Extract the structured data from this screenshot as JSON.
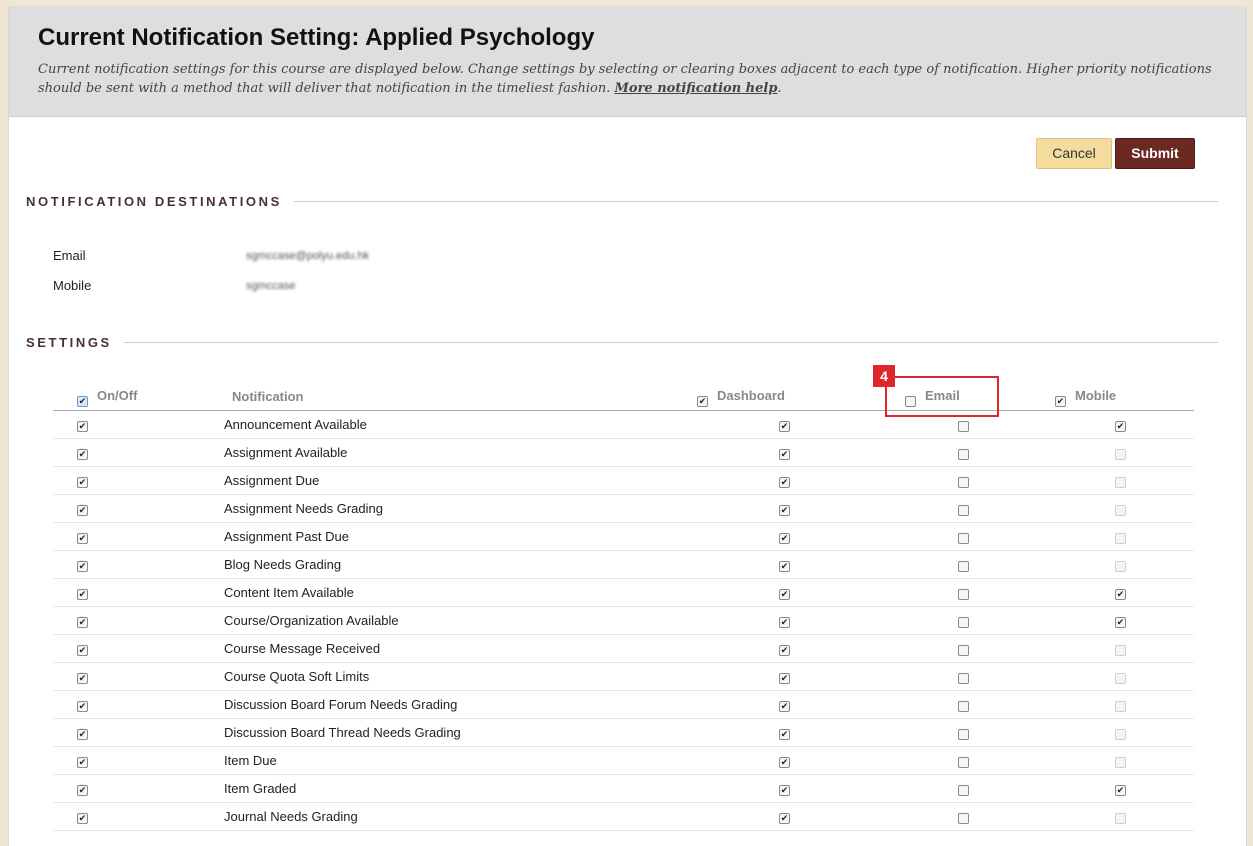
{
  "header": {
    "title": "Current Notification Setting: Applied Psychology",
    "description": "Current notification settings for this course are displayed below. Change settings by selecting or clearing boxes adjacent to each type of notification. Higher priority notifications should be sent with a method that will deliver that notification in the timeliest fashion.",
    "help_link": "More notification help",
    "help_suffix": "."
  },
  "buttons": {
    "cancel": "Cancel",
    "submit": "Submit"
  },
  "destinations": {
    "title": "NOTIFICATION DESTINATIONS",
    "email_label": "Email",
    "email_value": "sgmccase@polyu.edu.hk",
    "mobile_label": "Mobile",
    "mobile_value": "sgmccase"
  },
  "settings": {
    "title": "SETTINGS",
    "columns": {
      "onoff": "On/Off",
      "notification": "Notification",
      "dashboard": "Dashboard",
      "email": "Email",
      "mobile": "Mobile"
    },
    "header_checks": {
      "onoff": true,
      "dashboard": true,
      "email": false,
      "mobile": true
    },
    "rows": [
      {
        "name": "Announcement Available",
        "on": true,
        "dashboard": true,
        "email": false,
        "mobile": true,
        "mobile_enabled": true
      },
      {
        "name": "Assignment Available",
        "on": true,
        "dashboard": true,
        "email": false,
        "mobile": false,
        "mobile_enabled": false
      },
      {
        "name": "Assignment Due",
        "on": true,
        "dashboard": true,
        "email": false,
        "mobile": false,
        "mobile_enabled": false
      },
      {
        "name": "Assignment Needs Grading",
        "on": true,
        "dashboard": true,
        "email": false,
        "mobile": false,
        "mobile_enabled": false
      },
      {
        "name": "Assignment Past Due",
        "on": true,
        "dashboard": true,
        "email": false,
        "mobile": false,
        "mobile_enabled": false
      },
      {
        "name": "Blog Needs Grading",
        "on": true,
        "dashboard": true,
        "email": false,
        "mobile": false,
        "mobile_enabled": false
      },
      {
        "name": "Content Item Available",
        "on": true,
        "dashboard": true,
        "email": false,
        "mobile": true,
        "mobile_enabled": true
      },
      {
        "name": "Course/Organization Available",
        "on": true,
        "dashboard": true,
        "email": false,
        "mobile": true,
        "mobile_enabled": true
      },
      {
        "name": "Course Message Received",
        "on": true,
        "dashboard": true,
        "email": false,
        "mobile": false,
        "mobile_enabled": false
      },
      {
        "name": "Course Quota Soft Limits",
        "on": true,
        "dashboard": true,
        "email": false,
        "mobile": false,
        "mobile_enabled": false
      },
      {
        "name": "Discussion Board Forum Needs Grading",
        "on": true,
        "dashboard": true,
        "email": false,
        "mobile": false,
        "mobile_enabled": false
      },
      {
        "name": "Discussion Board Thread Needs Grading",
        "on": true,
        "dashboard": true,
        "email": false,
        "mobile": false,
        "mobile_enabled": false
      },
      {
        "name": "Item Due",
        "on": true,
        "dashboard": true,
        "email": false,
        "mobile": false,
        "mobile_enabled": false
      },
      {
        "name": "Item Graded",
        "on": true,
        "dashboard": true,
        "email": false,
        "mobile": true,
        "mobile_enabled": true
      },
      {
        "name": "Journal Needs Grading",
        "on": true,
        "dashboard": true,
        "email": false,
        "mobile": false,
        "mobile_enabled": false
      }
    ]
  },
  "annotation": {
    "badge": "4",
    "color": "#e0262d"
  }
}
